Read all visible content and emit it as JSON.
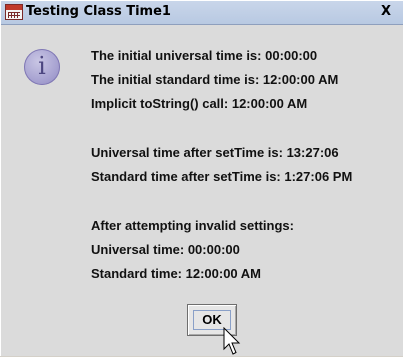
{
  "window": {
    "title": "Testing Class Time1",
    "close_glyph": "X"
  },
  "icons": {
    "app": "java-app-icon",
    "info": "information-icon",
    "info_glyph": "i",
    "cursor": "mouse-pointer-icon"
  },
  "messages": [
    "The initial universal time is: 00:00:00",
    "The initial standard time is: 12:00:00 AM",
    "Implicit toString() call: 12:00:00 AM",
    "Universal time after setTime is: 13:27:06",
    "Standard time after setTime is: 1:27:06 PM",
    "After attempting invalid settings:",
    "Universal time: 00:00:00",
    "Standard time: 12:00:00 AM"
  ],
  "buttons": {
    "ok_label": "OK"
  }
}
